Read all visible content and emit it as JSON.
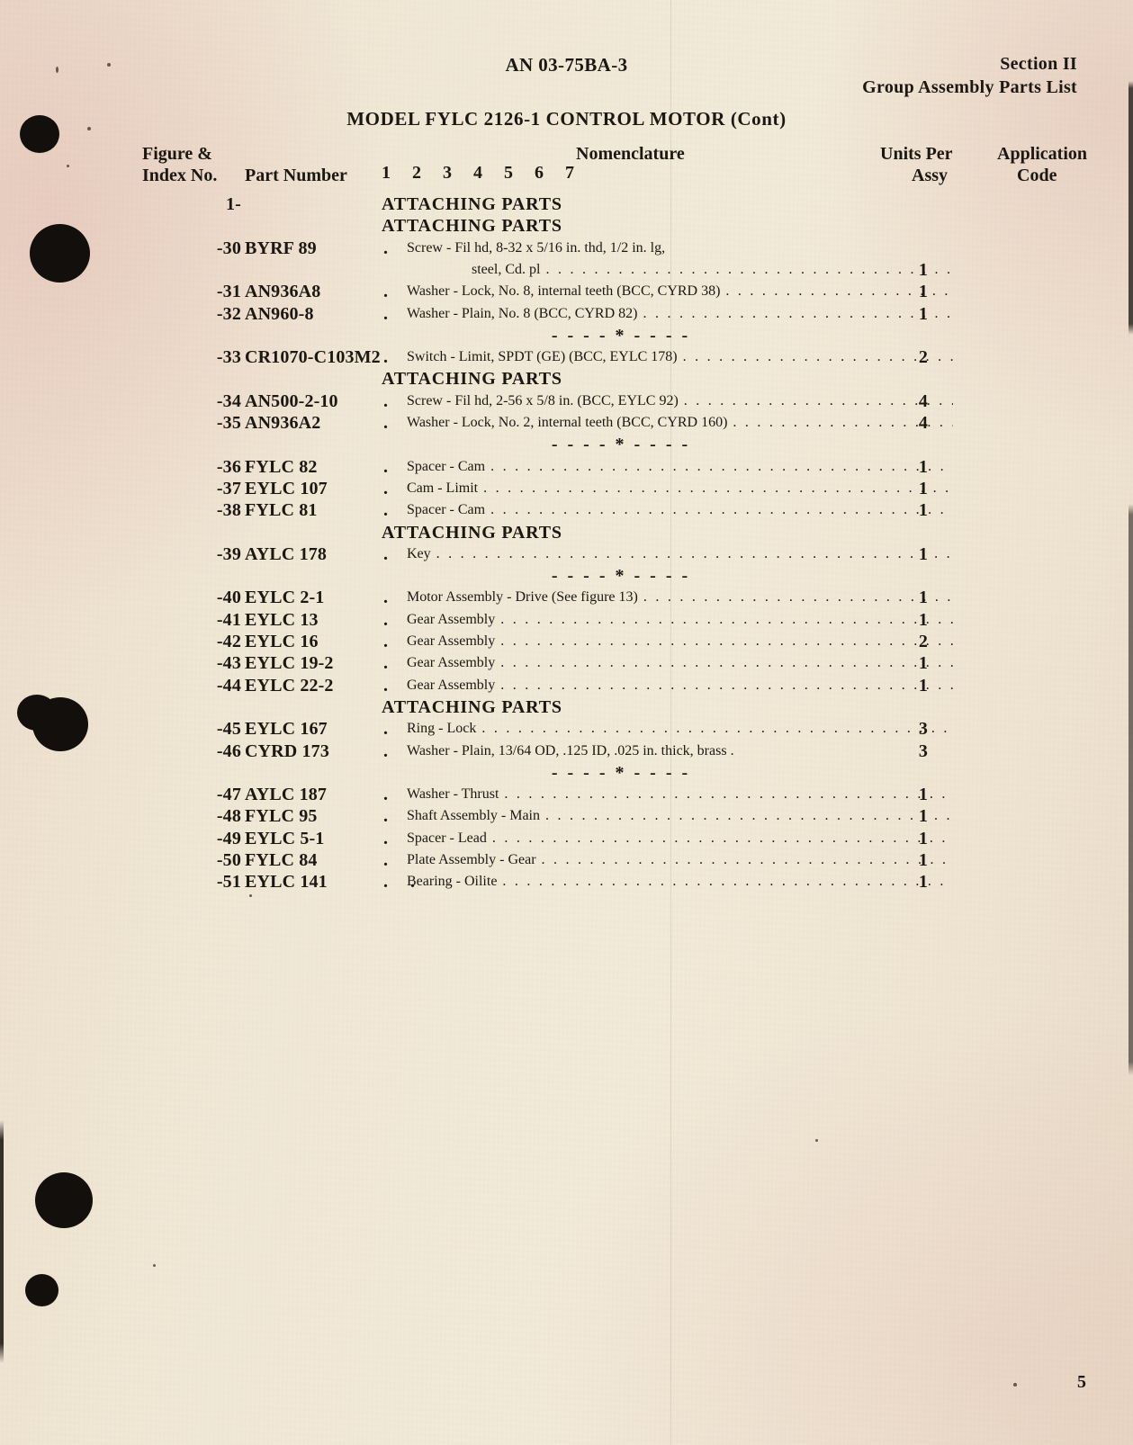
{
  "header": {
    "manual_number": "AN 03-75BA-3",
    "section": "Section II",
    "section_subtitle": "Group Assembly Parts List"
  },
  "title": "MODEL FYLC 2126-1 CONTROL MOTOR (Cont)",
  "columns": {
    "figure_line1": "Figure &",
    "figure_line2": "Index No.",
    "part_number": "Part Number",
    "nomenclature": "Nomenclature",
    "indent_digits": "1 2 3 4 5 6 7",
    "units_per": "Units Per",
    "assy": "Assy",
    "application": "Application",
    "code": "Code"
  },
  "labels": {
    "attaching_parts": "ATTACHING PARTS",
    "separator": "- - - - * - - - -",
    "figure_group": "1-",
    "leader_char": ".",
    "indent_dot": "."
  },
  "rows": [
    {
      "kind": "group",
      "index": "1-"
    },
    {
      "kind": "heading",
      "text": "ATTACHING PARTS"
    },
    {
      "kind": "item",
      "index": "-30",
      "part": "BYRF 89",
      "dots": 1,
      "nomenclature": "Screw - Fil hd, 8-32 x 5/16 in. thd, 1/2 in. lg,",
      "nomenclature_cont": "steel, Cd. pl",
      "qty": "1",
      "code": ""
    },
    {
      "kind": "item",
      "index": "-31",
      "part": "AN936A8",
      "dots": 1,
      "nomenclature": "Washer - Lock, No. 8, internal teeth (BCC, CYRD 38)",
      "qty": "1",
      "code": ""
    },
    {
      "kind": "item",
      "index": "-32",
      "part": "AN960-8",
      "dots": 1,
      "nomenclature": "Washer - Plain, No. 8 (BCC, CYRD 82)",
      "qty": "1",
      "code": ""
    },
    {
      "kind": "separator"
    },
    {
      "kind": "item",
      "index": "-33",
      "part": "CR1070-C103M2",
      "dots": 1,
      "nomenclature": "Switch - Limit, SPDT (GE) (BCC, EYLC 178)",
      "qty": "2",
      "code": ""
    },
    {
      "kind": "heading",
      "text": "ATTACHING PARTS"
    },
    {
      "kind": "item",
      "index": "-34",
      "part": "AN500-2-10",
      "dots": 1,
      "nomenclature": "Screw - Fil hd, 2-56 x 5/8 in. (BCC, EYLC 92)",
      "qty": "4",
      "code": ""
    },
    {
      "kind": "item",
      "index": "-35",
      "part": "AN936A2",
      "dots": 1,
      "nomenclature": "Washer - Lock, No. 2, internal teeth (BCC, CYRD 160)",
      "qty": "4",
      "code": ""
    },
    {
      "kind": "separator"
    },
    {
      "kind": "item",
      "index": "-36",
      "part": "FYLC 82",
      "dots": 1,
      "nomenclature": "Spacer - Cam",
      "qty": "1",
      "code": ""
    },
    {
      "kind": "item",
      "index": "-37",
      "part": "EYLC 107",
      "dots": 1,
      "nomenclature": "Cam - Limit",
      "qty": "1",
      "code": ""
    },
    {
      "kind": "item",
      "index": "-38",
      "part": "FYLC 81",
      "dots": 1,
      "nomenclature": "Spacer - Cam",
      "qty": "1",
      "code": ""
    },
    {
      "kind": "heading",
      "text": "ATTACHING PARTS"
    },
    {
      "kind": "item",
      "index": "-39",
      "part": "AYLC 178",
      "dots": 1,
      "nomenclature": "Key",
      "qty": "1",
      "code": ""
    },
    {
      "kind": "separator"
    },
    {
      "kind": "item",
      "index": "-40",
      "part": "EYLC 2-1",
      "dots": 1,
      "nomenclature": "Motor Assembly - Drive (See figure 13)",
      "qty": "1",
      "code": ""
    },
    {
      "kind": "item",
      "index": "-41",
      "part": "EYLC 13",
      "dots": 1,
      "nomenclature": "Gear Assembly",
      "qty": "1",
      "code": ""
    },
    {
      "kind": "item",
      "index": "-42",
      "part": "EYLC 16",
      "dots": 1,
      "nomenclature": "Gear Assembly",
      "qty": "2",
      "code": ""
    },
    {
      "kind": "item",
      "index": "-43",
      "part": "EYLC 19-2",
      "dots": 1,
      "nomenclature": "Gear Assembly",
      "qty": "1",
      "code": ""
    },
    {
      "kind": "item",
      "index": "-44",
      "part": "EYLC 22-2",
      "dots": 1,
      "nomenclature": "Gear Assembly",
      "qty": "1",
      "code": ""
    },
    {
      "kind": "heading",
      "text": "ATTACHING PARTS"
    },
    {
      "kind": "item",
      "index": "-45",
      "part": "EYLC 167",
      "dots": 1,
      "nomenclature": "Ring - Lock",
      "qty": "3",
      "code": ""
    },
    {
      "kind": "item",
      "index": "-46",
      "part": "CYRD 173",
      "dots": 1,
      "nomenclature": "Washer - Plain, 13/64 OD, .125 ID, .025 in. thick, brass",
      "no_leader": true,
      "qty": "3",
      "code": ""
    },
    {
      "kind": "separator"
    },
    {
      "kind": "item",
      "index": "-47",
      "part": "AYLC 187",
      "dots": 1,
      "nomenclature": "Washer - Thrust",
      "qty": "1",
      "code": ""
    },
    {
      "kind": "item",
      "index": "-48",
      "part": "FYLC 95",
      "dots": 1,
      "nomenclature": "Shaft Assembly - Main",
      "qty": "1",
      "code": ""
    },
    {
      "kind": "item",
      "index": "-49",
      "part": "EYLC 5-1",
      "dots": 1,
      "nomenclature": "Spacer - Lead",
      "qty": "1",
      "code": ""
    },
    {
      "kind": "item",
      "index": "-50",
      "part": "FYLC 84",
      "dots": 1,
      "nomenclature": "Plate Assembly - Gear",
      "qty": "1",
      "code": ""
    },
    {
      "kind": "item",
      "index": "-51",
      "part": "EYLC 141",
      "dots": 2,
      "nomenclature": "Bearing - Oilite",
      "qty": "1",
      "code": ""
    }
  ],
  "page_number": "5",
  "colors": {
    "paper": "#f0e7d5",
    "paper_warm_edge": "#e8d6c6",
    "ink": "#1b1713",
    "blob": "#120f0c"
  }
}
